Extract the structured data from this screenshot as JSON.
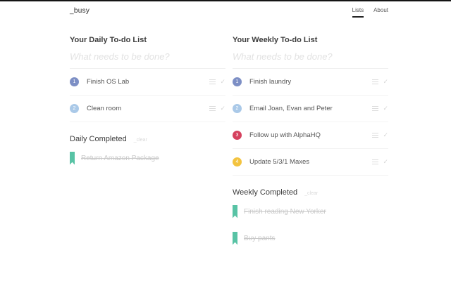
{
  "app": {
    "logo": "_busy"
  },
  "nav": {
    "items": [
      {
        "label": "Lists",
        "active": true
      },
      {
        "label": "About",
        "active": false
      }
    ]
  },
  "columns": [
    {
      "title": "Your Daily To-do List",
      "input_placeholder": "What needs to be done?",
      "input_value": "",
      "todos": [
        {
          "number": "1",
          "label": "Finish OS Lab",
          "badge_color": "#7d8fc5"
        },
        {
          "number": "2",
          "label": "Clean room",
          "badge_color": "#aac9e8"
        }
      ],
      "completed_title": "Daily Completed",
      "clear_label": "_clear",
      "completed": [
        {
          "label": "Return Amazon Package"
        }
      ]
    },
    {
      "title": "Your Weekly To-do List",
      "input_placeholder": "What needs to be done?",
      "input_value": "",
      "todos": [
        {
          "number": "1",
          "label": "Finish laundry",
          "badge_color": "#7d8fc5"
        },
        {
          "number": "2",
          "label": "Email Joan, Evan and Peter",
          "badge_color": "#aac9e8"
        },
        {
          "number": "3",
          "label": "Follow up with AlphaHQ",
          "badge_color": "#d5415e"
        },
        {
          "number": "4",
          "label": "Update 5/3/1 Maxes",
          "badge_color": "#f3c33f"
        }
      ],
      "completed_title": "Weekly Completed",
      "clear_label": "_clear",
      "completed": [
        {
          "label": "Finish reading New Yorker"
        },
        {
          "label": "Buy pants"
        }
      ]
    }
  ],
  "colors": {
    "accent_teal": "#58c3a5",
    "separator": "#f3f3f3",
    "icon_gray": "#dcdcdc",
    "done_text": "#c9c9c9"
  }
}
